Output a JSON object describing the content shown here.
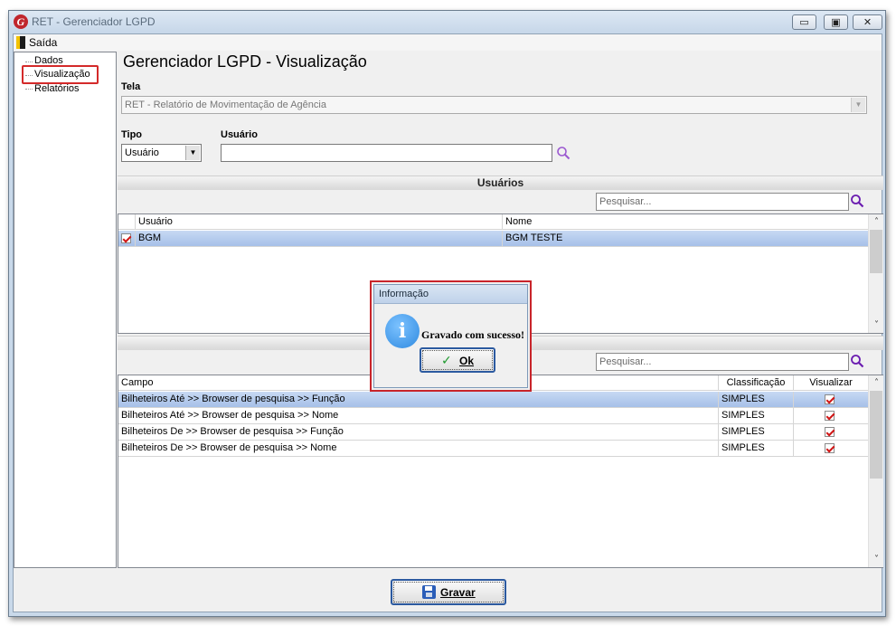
{
  "window": {
    "title": "RET - Gerenciador LGPD",
    "logo_letter": "G"
  },
  "menu": {
    "exit_label": "Saída"
  },
  "sidebar": {
    "items": [
      {
        "label": "Dados"
      },
      {
        "label": "Visualização",
        "selected": true
      },
      {
        "label": "Relatórios"
      }
    ]
  },
  "page": {
    "title": "Gerenciador LGPD - Visualização"
  },
  "form": {
    "tela_label": "Tela",
    "tela_value": "RET - Relatório de Movimentação de Agência",
    "tipo_label": "Tipo",
    "tipo_value": "Usuário",
    "usuario_label": "Usuário",
    "usuario_value": ""
  },
  "usuarios_section": {
    "title": "Usuários",
    "search_placeholder": "Pesquisar...",
    "columns": [
      "Usuário",
      "Nome"
    ],
    "rows": [
      {
        "usuario": "BGM",
        "nome": "BGM TESTE",
        "checked": true,
        "selected": true
      }
    ]
  },
  "campos_section": {
    "search_placeholder": "Pesquisar...",
    "columns": [
      "Campo",
      "Classificação",
      "Visualizar"
    ],
    "rows": [
      {
        "campo": "Bilheteiros Até >> Browser de pesquisa >> Função",
        "classificacao": "SIMPLES",
        "visualizar": true,
        "selected": true
      },
      {
        "campo": "Bilheteiros Até >> Browser de pesquisa >> Nome",
        "classificacao": "SIMPLES",
        "visualizar": true
      },
      {
        "campo": "Bilheteiros De >> Browser de pesquisa >> Função",
        "classificacao": "SIMPLES",
        "visualizar": true
      },
      {
        "campo": "Bilheteiros De >> Browser de pesquisa >> Nome",
        "classificacao": "SIMPLES",
        "visualizar": true
      }
    ]
  },
  "buttons": {
    "gravar": "Gravar",
    "ok": "Ok"
  },
  "dialog": {
    "title": "Informação",
    "message": "Gravado com sucesso!"
  },
  "colors": {
    "highlight_red": "#c8242a",
    "selection_blue": "#a6c0e8",
    "check_red": "#d01515"
  }
}
